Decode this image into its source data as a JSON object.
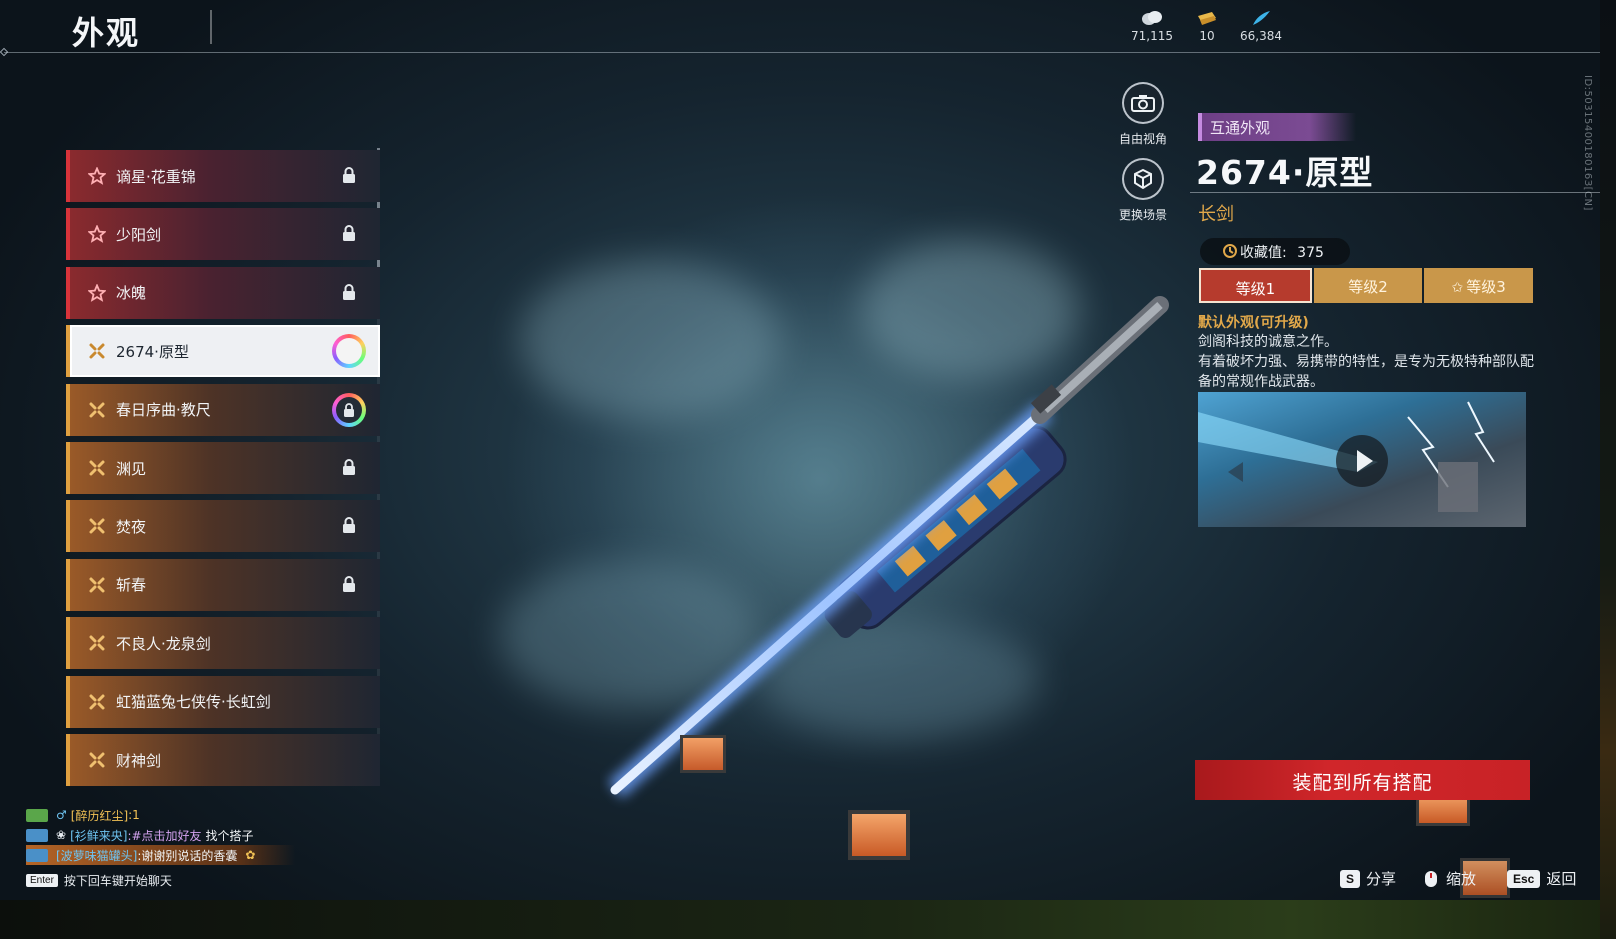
{
  "header": {
    "title": "外观",
    "currencies": [
      {
        "icon": "coin-stack-icon",
        "value": "71,115"
      },
      {
        "icon": "ticket-icon",
        "value": "10"
      },
      {
        "icon": "feather-icon",
        "value": "66,384"
      }
    ]
  },
  "list": {
    "items": [
      {
        "label": "谪星·花重锦",
        "rarity": "red",
        "icon": "star-icon",
        "status": "locked"
      },
      {
        "label": "少阳剑",
        "rarity": "red",
        "icon": "star-icon",
        "status": "locked"
      },
      {
        "label": "冰魄",
        "rarity": "red",
        "icon": "star-icon",
        "status": "locked"
      },
      {
        "label": "2674·原型",
        "rarity": "gold",
        "icon": "cross-icon",
        "status": "selected"
      },
      {
        "label": "春日序曲·教尺",
        "rarity": "gold",
        "icon": "cross-icon",
        "status": "ring-locked"
      },
      {
        "label": "渊见",
        "rarity": "gold",
        "icon": "cross-icon",
        "status": "locked"
      },
      {
        "label": "焚夜",
        "rarity": "gold",
        "icon": "cross-icon",
        "status": "locked"
      },
      {
        "label": "斩春",
        "rarity": "gold",
        "icon": "cross-icon",
        "status": "locked"
      },
      {
        "label": "不良人·龙泉剑",
        "rarity": "gold",
        "icon": "cross-icon",
        "status": "none"
      },
      {
        "label": "虹猫蓝兔七侠传·长虹剑",
        "rarity": "gold",
        "icon": "cross-icon",
        "status": "none"
      },
      {
        "label": "财神剑",
        "rarity": "gold",
        "icon": "cross-icon",
        "status": "none"
      }
    ]
  },
  "camera": {
    "free_view": "自由视角",
    "change_scene": "更换场景"
  },
  "detail": {
    "tag": "互通外观",
    "title": "2674·原型",
    "type": "长剑",
    "collection_label": "收藏值:",
    "collection_value": "375",
    "levels": [
      "等级1",
      "等级2",
      "等级3"
    ],
    "active_level": 0,
    "desc_heading": "默认外观(可升级)",
    "desc_line1": "剑阁科技的诚意之作。",
    "desc_line2": "有着破坏力强、易携带的特性，是专为无极特种部队配备的常规作战武器。",
    "equip_button": "装配到所有搭配",
    "build_id": "ID:5031540018016З[CN]"
  },
  "chat": {
    "lines": [
      {
        "name": "[醉历红尘]",
        "msg": ":1",
        "chip": "#5aa64a"
      },
      {
        "name": "[衫鲜来央]",
        "link": ":#点击加好友",
        "msg": "找个搭子",
        "chip": "#4a90c8"
      },
      {
        "name": "[波萝味猫罐头]",
        "msg": ":谢谢别说话的香囊",
        "chip": "#4a90c8",
        "highlight": true
      }
    ],
    "hint_key": "Enter",
    "hint": "按下回车键开始聊天"
  },
  "footer": {
    "share_key": "S",
    "share": "分享",
    "zoom": "缩放",
    "back_key": "Esc",
    "back": "返回"
  },
  "colors": {
    "red_rarity": "#d8333a",
    "gold_rarity": "#e0a040",
    "accent_gold": "#e1a84a",
    "equip_red": "#c82226"
  }
}
